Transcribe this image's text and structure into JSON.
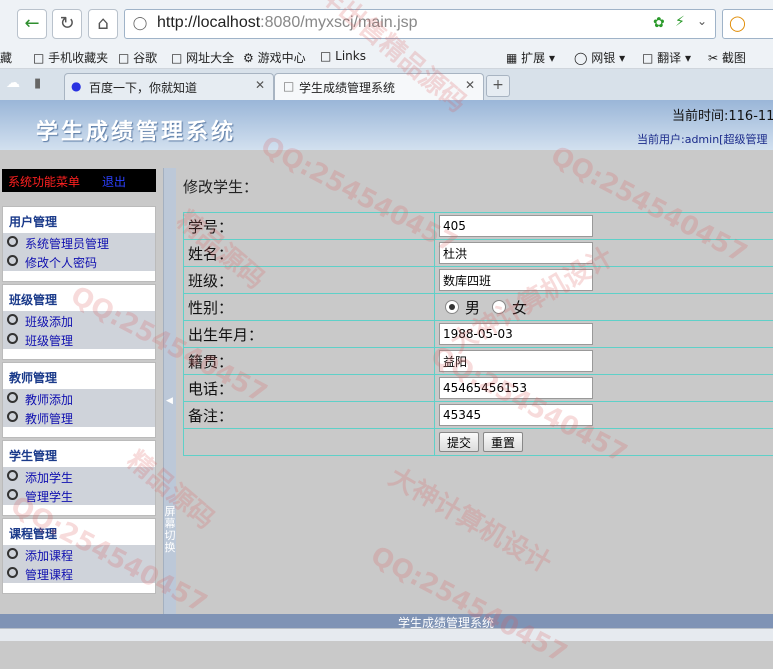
{
  "browser": {
    "url_host": "http://localhost",
    "url_path": ":8080/myxscj/main.jsp",
    "bookmarks": [
      "藏",
      "手机收藏夹",
      "谷歌",
      "网址大全",
      "游戏中心",
      "Links",
      "扩展",
      "网银",
      "翻译",
      "截图"
    ],
    "tabs": [
      {
        "label": "百度一下，你就知道"
      },
      {
        "label": "学生成绩管理系统"
      }
    ]
  },
  "header": {
    "title": "学生成绩管理系统",
    "time_label": "当前时间:116-11",
    "user_label": "当前用户:admin[超级管理"
  },
  "menu": {
    "title": "系统功能菜单",
    "logout": "退出",
    "groups": [
      {
        "title": "用户管理",
        "items": [
          "系统管理员管理",
          "修改个人密码"
        ]
      },
      {
        "title": "班级管理",
        "items": [
          "班级添加",
          "班级管理"
        ]
      },
      {
        "title": "教师管理",
        "items": [
          "教师添加",
          "教师管理"
        ]
      },
      {
        "title": "学生管理",
        "items": [
          "添加学生",
          "管理学生"
        ]
      },
      {
        "title": "课程管理",
        "items": [
          "添加课程",
          "管理课程"
        ]
      }
    ]
  },
  "splitter": {
    "label": "屏幕切换"
  },
  "form": {
    "title": "修改学生：",
    "fields": {
      "student_no": {
        "label": "学号：",
        "value": "405"
      },
      "name": {
        "label": "姓名：",
        "value": "杜洪"
      },
      "class": {
        "label": "班级：",
        "value": "数库四班"
      },
      "gender": {
        "label": "性别：",
        "male": "男",
        "female": "女",
        "selected": "男"
      },
      "birth": {
        "label": "出生年月：",
        "value": "1988-05-03"
      },
      "native": {
        "label": "籍贯：",
        "value": "益阳"
      },
      "phone": {
        "label": "电话：",
        "value": "45465456153"
      },
      "remark": {
        "label": "备注：",
        "value": "45345"
      }
    },
    "submit": "提交",
    "reset": "重置"
  },
  "footer": {
    "text": "学生成绩管理系统"
  },
  "watermark": {
    "qq": "QQ:254540457",
    "a": "大神计算机设计",
    "b": "精品源码",
    "c": "常年出售精品源码"
  }
}
